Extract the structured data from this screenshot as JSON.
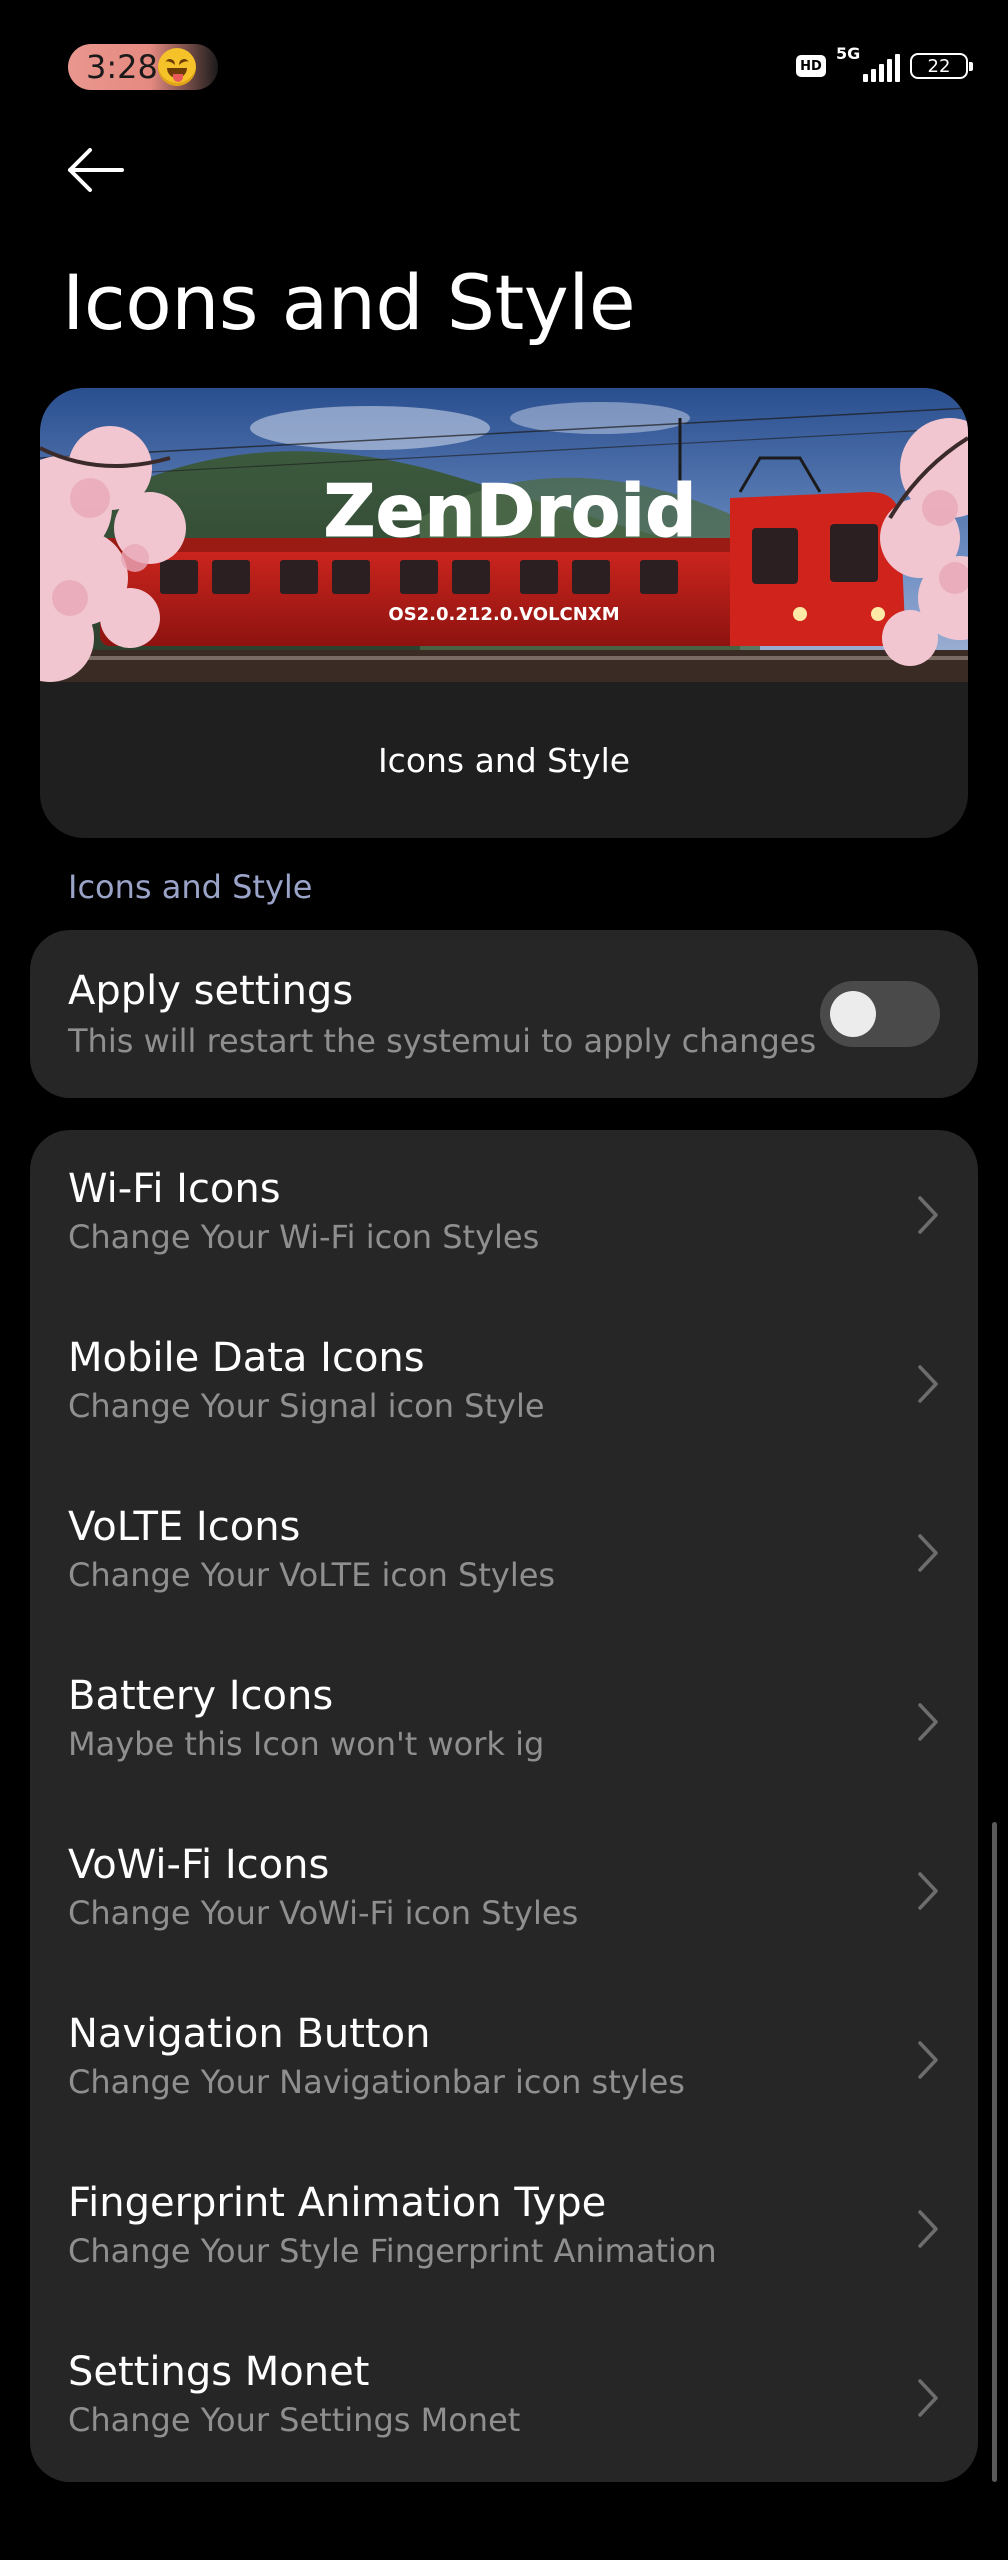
{
  "status_bar": {
    "time": "3:28",
    "hd_badge": "HD",
    "network": "5G",
    "battery": "22"
  },
  "page": {
    "title": "Icons and Style"
  },
  "banner": {
    "brand": "ZenDroid",
    "version": "OS2.0.212.0.VOLCNXM",
    "caption": "Icons and Style"
  },
  "section": {
    "header": "Icons and Style"
  },
  "apply": {
    "title": "Apply settings",
    "subtitle": "This will restart the systemui to apply changes",
    "enabled": false
  },
  "items": [
    {
      "title": "Wi-Fi Icons",
      "subtitle": "Change Your Wi-Fi icon Styles"
    },
    {
      "title": "Mobile Data Icons",
      "subtitle": "Change Your Signal icon Style"
    },
    {
      "title": "VoLTE Icons",
      "subtitle": "Change Your VoLTE icon Styles"
    },
    {
      "title": "Battery Icons",
      "subtitle": "Maybe this Icon won't work ig"
    },
    {
      "title": "VoWi-Fi Icons",
      "subtitle": "Change Your VoWi-Fi icon Styles"
    },
    {
      "title": "Navigation Button",
      "subtitle": "Change Your Navigationbar icon styles"
    },
    {
      "title": "Fingerprint Animation Type",
      "subtitle": "Change Your Style Fingerprint Animation"
    },
    {
      "title": "Settings Monet",
      "subtitle": "Change Your Settings Monet"
    }
  ],
  "icons": {
    "back": "arrow-left-icon",
    "chevron": "chevron-right-icon",
    "emoji": "squinting-tongue-emoji"
  },
  "colors": {
    "background": "#000000",
    "card": "#262626",
    "section_header": "#9aa3c8",
    "subtitle": "#8f8f8f",
    "time_pill": "#e9978f",
    "train_red": "#c8201c"
  }
}
